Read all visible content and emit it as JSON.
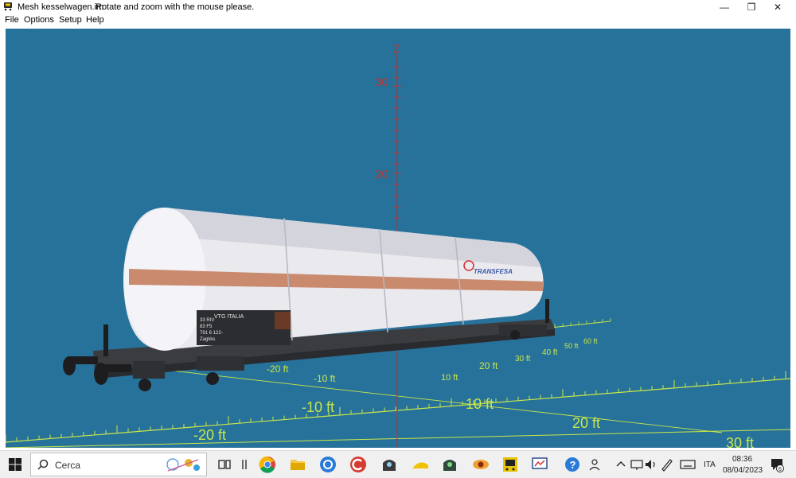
{
  "window": {
    "title": "Mesh kesselwagen.im",
    "hint": "Rotate and zoom with the mouse please."
  },
  "window_controls": {
    "minimize": "—",
    "restore": "❐",
    "close": "✕"
  },
  "menu": {
    "items": [
      "File",
      "Options",
      "Setup",
      "Help"
    ]
  },
  "scene": {
    "axis_label": "Z",
    "z_ticks": [
      "30",
      "20"
    ],
    "near_ground_labels": [
      "-20 ft",
      "-10 ft",
      "10 ft",
      "20 ft",
      "30 ft"
    ],
    "far_ground_labels": [
      "-20 ft",
      "-10 ft",
      "20 ft",
      "30 ft",
      "40 ft",
      "50 ft",
      "60 ft"
    ],
    "near_center_label": "10 ft",
    "wagon": {
      "brand": "TRANSFESA",
      "plate_lines": [
        "VTG ITALIA",
        "33 RIV",
        "83 F5",
        "791 6 122-",
        "Zagkks"
      ]
    },
    "colors": {
      "background": "#27729a",
      "grid": "#c8e64a",
      "axis": "#b03a3a",
      "tank": "#e9e9ee",
      "stripe": "#c98a6e"
    }
  },
  "taskbar": {
    "search_placeholder": "Cerca",
    "language": "ITA",
    "time": "08:36",
    "date": "08/04/2023",
    "notifications": "6"
  }
}
